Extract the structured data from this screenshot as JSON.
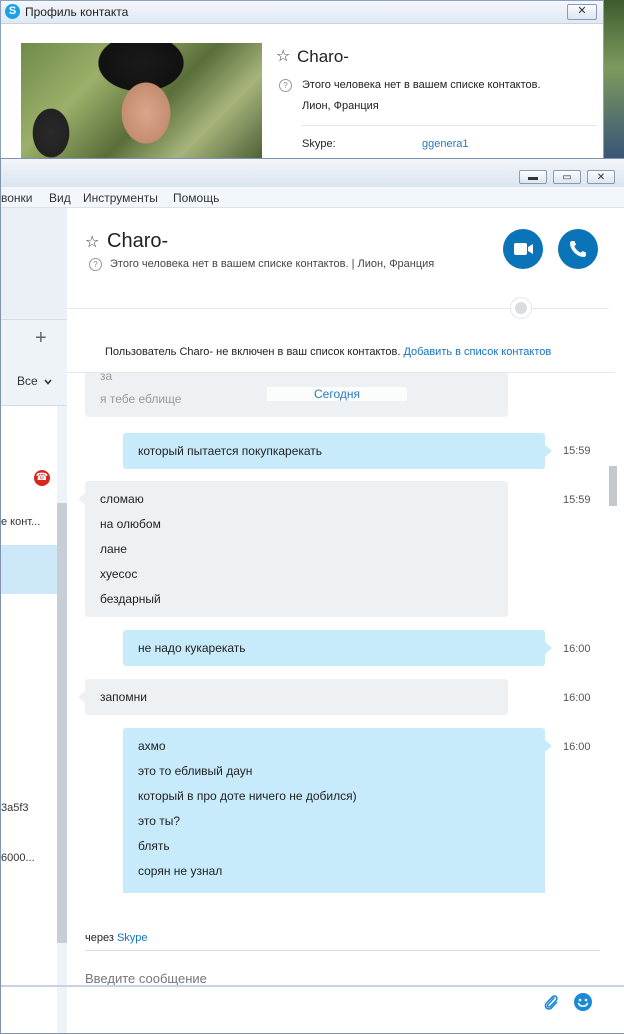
{
  "profile_window": {
    "title": "Профиль контакта",
    "close_label": "✕",
    "contact_name": "Charo-",
    "note": "Этого человека нет в вашем списке контактов.",
    "location": "Лион, Франция",
    "skype_label": "Skype:",
    "skype_value": "ggenera1"
  },
  "main_window": {
    "buttons": {
      "minimize": "▬",
      "maximize": "▭",
      "close": "✕"
    },
    "menu": [
      "вонки",
      "Вид",
      "Инструменты",
      "Помощь"
    ]
  },
  "sidebar": {
    "add_label": "+",
    "filter_label": "Все",
    "contact_snippet": "е конт...",
    "contact_id_1": "3a5f3",
    "contact_id_2": "6000..."
  },
  "chat": {
    "contact_name": "Charo-",
    "status_line": "Этого человека нет в вашем списке контактов.  |  Лион, Франция",
    "notice_text": "Пользователь Charo- не включен в ваш список контактов.",
    "notice_link": "Добавить в список контактов",
    "today_label": "Сегодня",
    "prev_message_lines": [
      "за",
      "я тебе еблище"
    ],
    "messages": [
      {
        "direction": "out",
        "time": "15:59",
        "lines": [
          "который пытается покупкарекать"
        ]
      },
      {
        "direction": "in",
        "time": "15:59",
        "lines": [
          "сломаю",
          "на олюбом",
          "лане",
          "хуесос",
          "бездарный"
        ]
      },
      {
        "direction": "out",
        "time": "16:00",
        "lines": [
          "не надо кукарекать"
        ]
      },
      {
        "direction": "in",
        "time": "16:00",
        "lines": [
          "запомни"
        ]
      },
      {
        "direction": "out",
        "time": "16:00",
        "lines": [
          "ахмо",
          "это то ебливый даун",
          "который в про доте ничего не добился)",
          "это ты?",
          "блять",
          "сорян не узнал"
        ]
      }
    ],
    "via_prefix": "через",
    "via_link": "Skype",
    "input_placeholder": "Введите сообщение"
  },
  "colors": {
    "accent": "#0b73b8",
    "outgoing_bubble": "#c7ebfb",
    "incoming_bubble": "#eef1f4",
    "link": "#1473c6",
    "missed_call": "#d9261c"
  },
  "icons": [
    "skype-logo-icon",
    "star-icon",
    "info-icon",
    "video-icon",
    "phone-icon",
    "globe-icon",
    "plus-icon",
    "chevron-down-icon",
    "missed-call-icon",
    "paperclip-icon",
    "emoji-icon"
  ]
}
